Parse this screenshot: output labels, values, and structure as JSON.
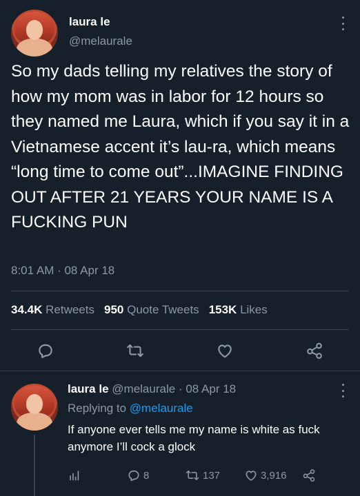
{
  "main_tweet": {
    "display_name": "laura le",
    "handle": "@melaurale",
    "text": "So my dads telling my relatives the story of how my mom was in labor for 12 hours so they named me Laura, which if you say it in a Vietnamese accent it’s lau-ra, which means “long time to come out”...IMAGINE FINDING OUT AFTER 21 YEARS YOUR NAME IS A FUCKING PUN",
    "timestamp": "8:01 AM · 08 Apr 18",
    "stats": {
      "retweets_count": "34.4K",
      "retweets_label": "Retweets",
      "quote_count": "950",
      "quote_label": "Quote Tweets",
      "likes_count": "153K",
      "likes_label": "Likes"
    },
    "action_icons": [
      "reply-icon",
      "retweet-icon",
      "like-icon",
      "share-icon"
    ]
  },
  "reply_tweet": {
    "display_name": "laura le",
    "handle": "@melaurale",
    "separator": "·",
    "date": "08 Apr 18",
    "replying_prefix": "Replying to",
    "replying_to": "@melaurale",
    "text": "If anyone ever tells me my name is white as fuck anymore I’ll cock a glock",
    "counts": {
      "replies": "8",
      "retweets": "137",
      "likes": "3,916"
    },
    "action_icons": [
      "analytics-icon",
      "reply-icon",
      "retweet-icon",
      "like-icon",
      "share-icon"
    ]
  },
  "colors": {
    "background": "#15202b",
    "primary_text": "#ffffff",
    "secondary_text": "#8b98a5",
    "link": "#1d9bf0",
    "divider": "#38444d"
  }
}
